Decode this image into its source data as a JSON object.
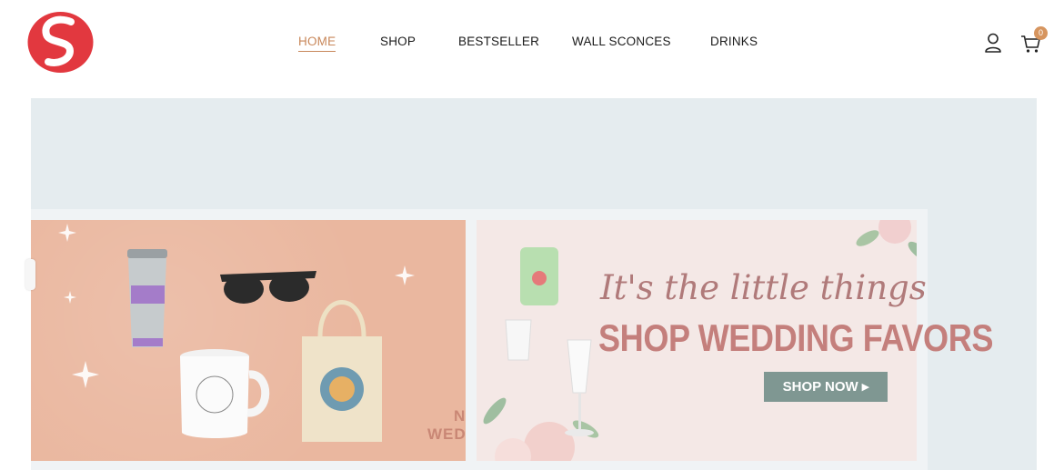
{
  "header": {
    "logo_icon": "red-s-logo-icon",
    "nav": [
      {
        "label": "HOME",
        "active": true
      },
      {
        "label": "SHOP",
        "active": false
      },
      {
        "label": "BESTSELLER",
        "active": false
      },
      {
        "label": "WALL SCONCES",
        "active": false
      },
      {
        "label": "DRINKS",
        "active": false
      }
    ],
    "user_icon": "user-icon",
    "cart_icon": "cart-icon",
    "cart_count": "0"
  },
  "banner": {
    "right_slide": {
      "script_text": "It's the little things",
      "headline": "SHOP WEDDING FAVORS",
      "cta_label": "SHOP NOW ▸"
    },
    "left_slide": {
      "partial_text_1": "N",
      "partial_text_2": "WED"
    }
  },
  "colors": {
    "accent": "#c8875a",
    "logo_red": "#e2383f",
    "cta_bg": "#7f9792",
    "banner_bg": "#e5ecef"
  }
}
